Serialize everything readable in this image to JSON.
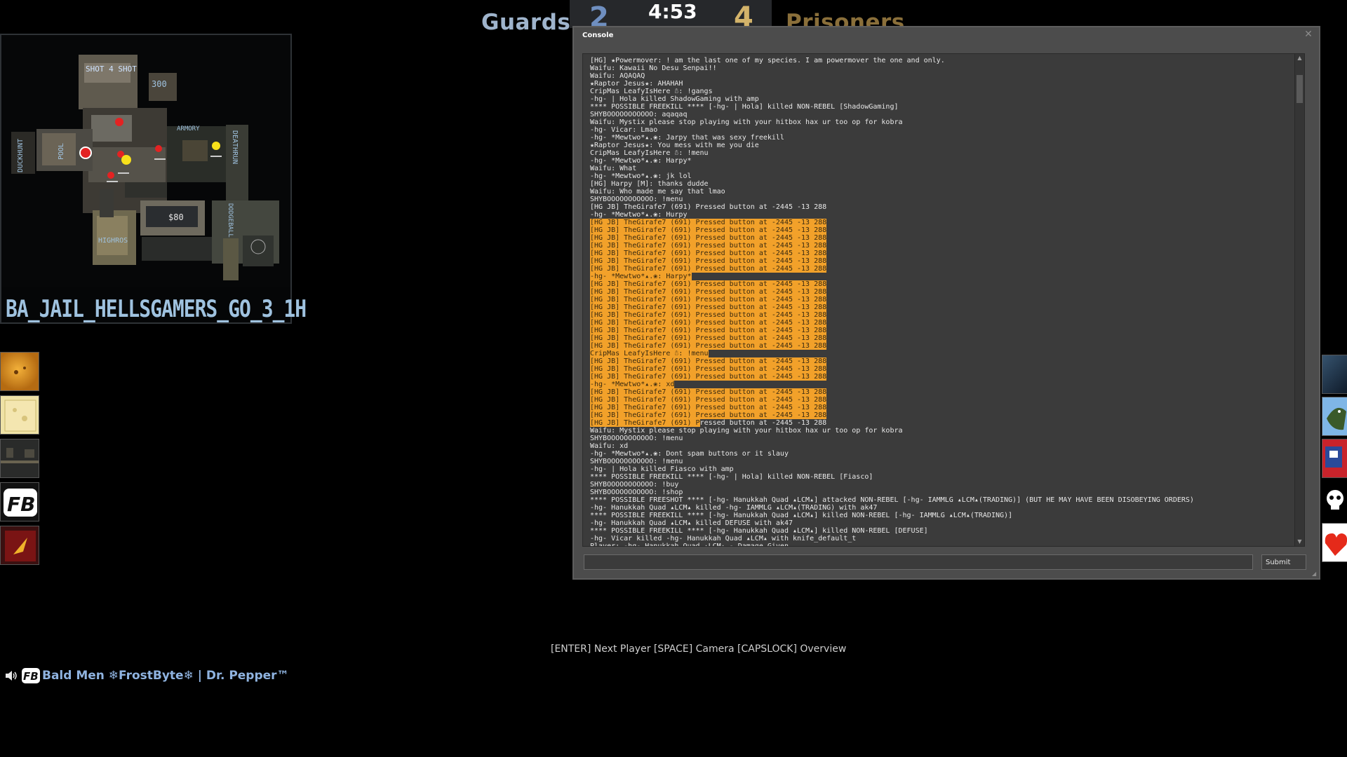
{
  "scoreboard": {
    "guards_label": "Guards",
    "prisoners_label": "Prisoners",
    "guards_score": "2",
    "prisoners_score": "4",
    "timer": "4:53"
  },
  "radar": {
    "map_name": "BA_JAIL_HELLSGAMERS_GO_3_1H",
    "labels": [
      "SHOT 4 SHOT",
      "300",
      "ARMORY",
      "DEATHRUN",
      "DUCKHUNT",
      "POOL",
      "$80",
      "HIGHROS",
      "DODGEBALL"
    ]
  },
  "left_avatars": [
    "avatar-food",
    "avatar-cheese",
    "avatar-room",
    "avatar-fb-logo",
    "avatar-red-logo"
  ],
  "right_avatars": [
    "avatar-dark-blue",
    "avatar-bird",
    "avatar-red-comic",
    "avatar-skull",
    "avatar-heart"
  ],
  "console": {
    "title": "Console",
    "submit_label": "Submit",
    "input_value": "",
    "lines": [
      {
        "text": "[HG] ★Powermover: ! am the last one of my species. I am powermover the one and only.",
        "hl": 0
      },
      {
        "text": "Waifu: Kawaii No Desu Senpai!!",
        "hl": 0
      },
      {
        "text": "Waifu: AQAQAQ",
        "hl": 0
      },
      {
        "text": "★Raptor Jesus★: AHAHAH",
        "hl": 0
      },
      {
        "text": "CripMas LeafyIsHere ☃: !gangs",
        "hl": 0
      },
      {
        "text": "-hg- | Hola killed ShadowGaming with amp",
        "hl": 0
      },
      {
        "text": "**** POSSIBLE FREEKILL **** [-hg- | Hola] killed NON-REBEL [ShadowGaming]",
        "hl": 0
      },
      {
        "text": "SHYBOOOOOOOOOOO: aqaqaq",
        "hl": 0
      },
      {
        "text": "Waifu: Mystix please stop playing with your hitbox hax ur too op for kobra",
        "hl": 0
      },
      {
        "text": "-hg- Vicar: Lmao",
        "hl": 0
      },
      {
        "text": "-hg- *Mewtwo*▴.❀: Jarpy that was sexy freekill",
        "hl": 0
      },
      {
        "text": "★Raptor Jesus★: You mess with me you die",
        "hl": 0
      },
      {
        "text": "CripMas LeafyIsHere ☃: !menu",
        "hl": 0
      },
      {
        "text": "-hg- *Mewtwo*▴.❀: Harpy*",
        "hl": 0
      },
      {
        "text": "Waifu: What",
        "hl": 0
      },
      {
        "text": "-hg- *Mewtwo*▴.❀: jk lol",
        "hl": 0
      },
      {
        "text": "[HG] Harpy [M]: thanks dudde",
        "hl": 0
      },
      {
        "text": "Waifu: Who made me say that lmao",
        "hl": 0
      },
      {
        "text": "SHYBOOOOOOOOOOO: !menu",
        "hl": 0
      },
      {
        "text": "[HG JB] TheGirafe7 (691) Pressed button at -2445 -13 288",
        "hl": 0
      },
      {
        "text": "-hg- *Mewtwo*▴.❀: Hurpy",
        "hl": 0
      },
      {
        "text": "[HG JB] TheGirafe7 (691) Pressed button at -2445 -13 288",
        "hl": 1
      },
      {
        "text": "[HG JB] TheGirafe7 (691) Pressed button at -2445 -13 288",
        "hl": 1
      },
      {
        "text": "[HG JB] TheGirafe7 (691) Pressed button at -2445 -13 288",
        "hl": 1
      },
      {
        "text": "[HG JB] TheGirafe7 (691) Pressed button at -2445 -13 288",
        "hl": 1
      },
      {
        "text": "[HG JB] TheGirafe7 (691) Pressed button at -2445 -13 288",
        "hl": 1
      },
      {
        "text": "[HG JB] TheGirafe7 (691) Pressed button at -2445 -13 288",
        "hl": 1
      },
      {
        "text": "[HG JB] TheGirafe7 (691) Pressed button at -2445 -13 288",
        "hl": 1
      },
      {
        "text": "-hg- *Mewtwo*▴.❀: Harpy*",
        "hl": 1
      },
      {
        "text": "[HG JB] TheGirafe7 (691) Pressed button at -2445 -13 288",
        "hl": 1
      },
      {
        "text": "[HG JB] TheGirafe7 (691) Pressed button at -2445 -13 288",
        "hl": 1
      },
      {
        "text": "[HG JB] TheGirafe7 (691) Pressed button at -2445 -13 288",
        "hl": 1
      },
      {
        "text": "[HG JB] TheGirafe7 (691) Pressed button at -2445 -13 288",
        "hl": 1
      },
      {
        "text": "[HG JB] TheGirafe7 (691) Pressed button at -2445 -13 288",
        "hl": 1
      },
      {
        "text": "[HG JB] TheGirafe7 (691) Pressed button at -2445 -13 288",
        "hl": 1
      },
      {
        "text": "[HG JB] TheGirafe7 (691) Pressed button at -2445 -13 288",
        "hl": 1
      },
      {
        "text": "[HG JB] TheGirafe7 (691) Pressed button at -2445 -13 288",
        "hl": 1
      },
      {
        "text": "[HG JB] TheGirafe7 (691) Pressed button at -2445 -13 288",
        "hl": 1
      },
      {
        "text": "CripMas LeafyIsHere ☃: !menu",
        "hl": 1
      },
      {
        "text": "[HG JB] TheGirafe7 (691) Pressed button at -2445 -13 288",
        "hl": 1
      },
      {
        "text": "[HG JB] TheGirafe7 (691) Pressed button at -2445 -13 288",
        "hl": 1
      },
      {
        "text": "[HG JB] TheGirafe7 (691) Pressed button at -2445 -13 288",
        "hl": 1
      },
      {
        "text": "-hg- *Mewtwo*▴.❀: xd",
        "hl": 1
      },
      {
        "text": "[HG JB] TheGirafe7 (691) Pressed button at -2445 -13 288",
        "hl": 1
      },
      {
        "text": "[HG JB] TheGirafe7 (691) Pressed button at -2445 -13 288",
        "hl": 1
      },
      {
        "text": "[HG JB] TheGirafe7 (691) Pressed button at -2445 -13 288",
        "hl": 1
      },
      {
        "text": "[HG JB] TheGirafe7 (691) Pressed button at -2445 -13 288",
        "hl": 1
      },
      {
        "text": "[HG JB] TheGirafe7 (691) Pressed button at -2445 -13 288",
        "hl": 2
      },
      {
        "text": "Waifu: Mystix please stop playing with your hitbox hax ur too op for kobra",
        "hl": 0
      },
      {
        "text": "SHYBOOOOOOOOOOO: !menu",
        "hl": 0
      },
      {
        "text": "Waifu: xd",
        "hl": 0
      },
      {
        "text": "-hg- *Mewtwo*▴.❀: Dont spam buttons or it slauy",
        "hl": 0
      },
      {
        "text": "SHYBOOOOOOOOOOO: !menu",
        "hl": 0
      },
      {
        "text": "-hg- | Hola killed Fiasco with amp",
        "hl": 0
      },
      {
        "text": "**** POSSIBLE FREEKILL **** [-hg- | Hola] killed NON-REBEL [Fiasco]",
        "hl": 0
      },
      {
        "text": "SHYBOOOOOOOOOOO: !buy",
        "hl": 0
      },
      {
        "text": "SHYBOOOOOOOOOOO: !shop",
        "hl": 0
      },
      {
        "text": "**** POSSIBLE FREESHOT **** [-hg- Hanukkah Quad ▴LCM▴] attacked NON-REBEL [-hg- IAMMLG ▴LCM▴(TRADING)] (BUT HE MAY HAVE BEEN DISOBEYING ORDERS)",
        "hl": 0
      },
      {
        "text": "-hg- Hanukkah Quad ▴LCM▴ killed -hg- IAMMLG ▴LCM▴(TRADING) with ak47",
        "hl": 0
      },
      {
        "text": "**** POSSIBLE FREEKILL **** [-hg- Hanukkah Quad ▴LCM▴] killed NON-REBEL [-hg- IAMMLG ▴LCM▴(TRADING)]",
        "hl": 0
      },
      {
        "text": "-hg- Hanukkah Quad ▴LCM▴ killed DEFUSE with ak47",
        "hl": 0
      },
      {
        "text": "**** POSSIBLE FREEKILL **** [-hg- Hanukkah Quad ▴LCM▴] killed NON-REBEL [DEFUSE]",
        "hl": 0
      },
      {
        "text": "-hg- Vicar killed -hg- Hanukkah Quad ▴LCM▴ with knife_default_t",
        "hl": 0
      },
      {
        "text": "Player: -hg- Hanukkah Quad ▴LCM▴ - Damage Given",
        "hl": 0
      }
    ]
  },
  "spectator_hint": "[ENTER] Next Player [SPACE] Camera  [CAPSLOCK] Overview",
  "player_bar": {
    "name": "Bald Men ❄FrostByte❄ | Dr. Pepper™"
  },
  "colors": {
    "highlight": "#f2a12a",
    "guards_blue": "#6f8fc0",
    "prisoners_gold": "#d3b36a"
  }
}
